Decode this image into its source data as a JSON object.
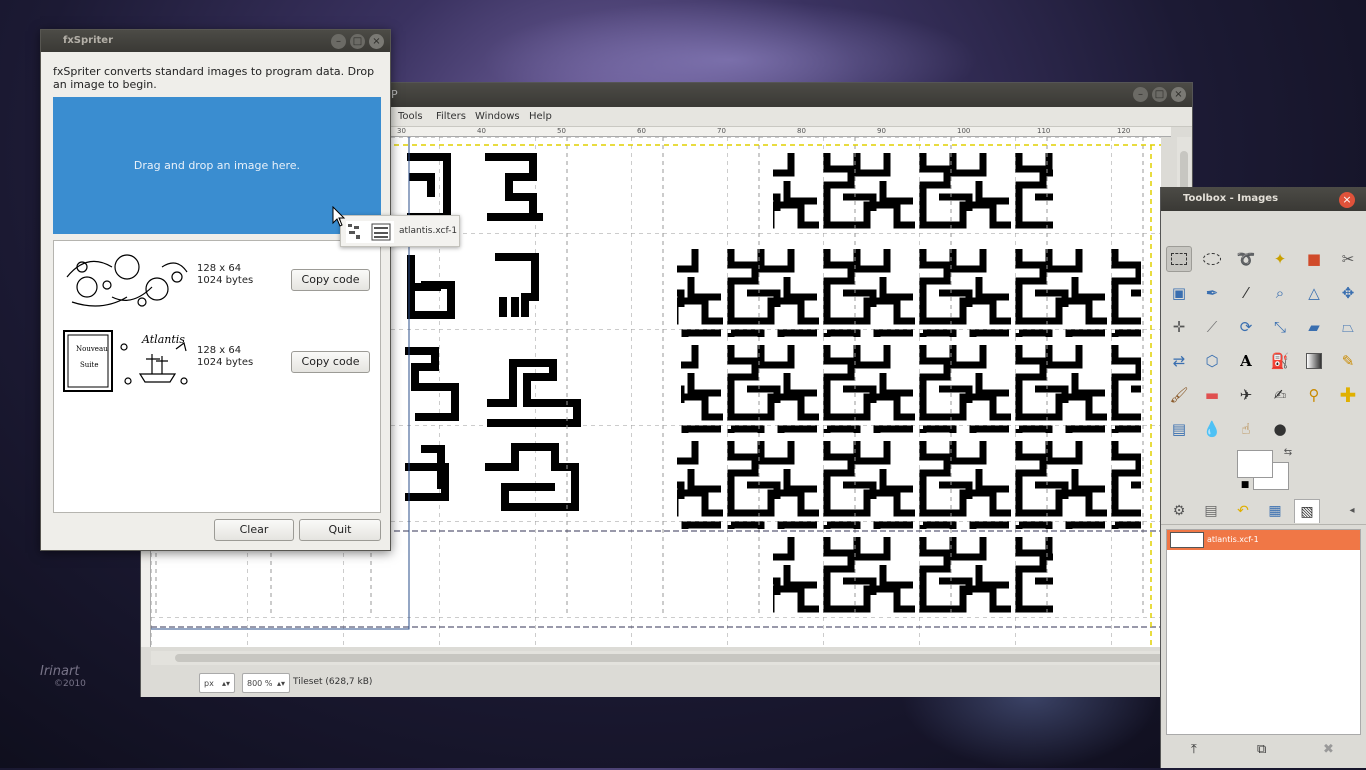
{
  "desktop": {
    "watermark": "Irinart",
    "watermark_year": "©2010"
  },
  "gimp": {
    "title": "P",
    "menu": [
      "Tools",
      "Filters",
      "Windows",
      "Help"
    ],
    "ruler_ticks": [
      "30",
      "40",
      "50",
      "60",
      "70",
      "80",
      "90",
      "100",
      "110",
      "120"
    ],
    "unit": "px",
    "zoom": "800 %",
    "status": "Tileset (628,7 kB)"
  },
  "fxspriter": {
    "title": "fxSpriter",
    "intro": "fxSpriter converts standard images to program data. Drop an image to begin.",
    "drop_label": "Drag and drop an image here.",
    "items": [
      {
        "size": "128 x 64",
        "bytes": "1024 bytes",
        "button": "Copy code"
      },
      {
        "size": "128 x 64",
        "bytes": "1024 bytes",
        "button": "Copy code"
      }
    ],
    "clear_label": "Clear",
    "quit_label": "Quit"
  },
  "drag": {
    "label": "atlantis.xcf-1"
  },
  "toolbox": {
    "title": "Toolbox - Images",
    "image_name": "atlantis.xcf-1"
  },
  "colors": {
    "accent_blue": "#3a8dd0",
    "selection_orange": "#f07746",
    "close_red": "#e0523a"
  }
}
